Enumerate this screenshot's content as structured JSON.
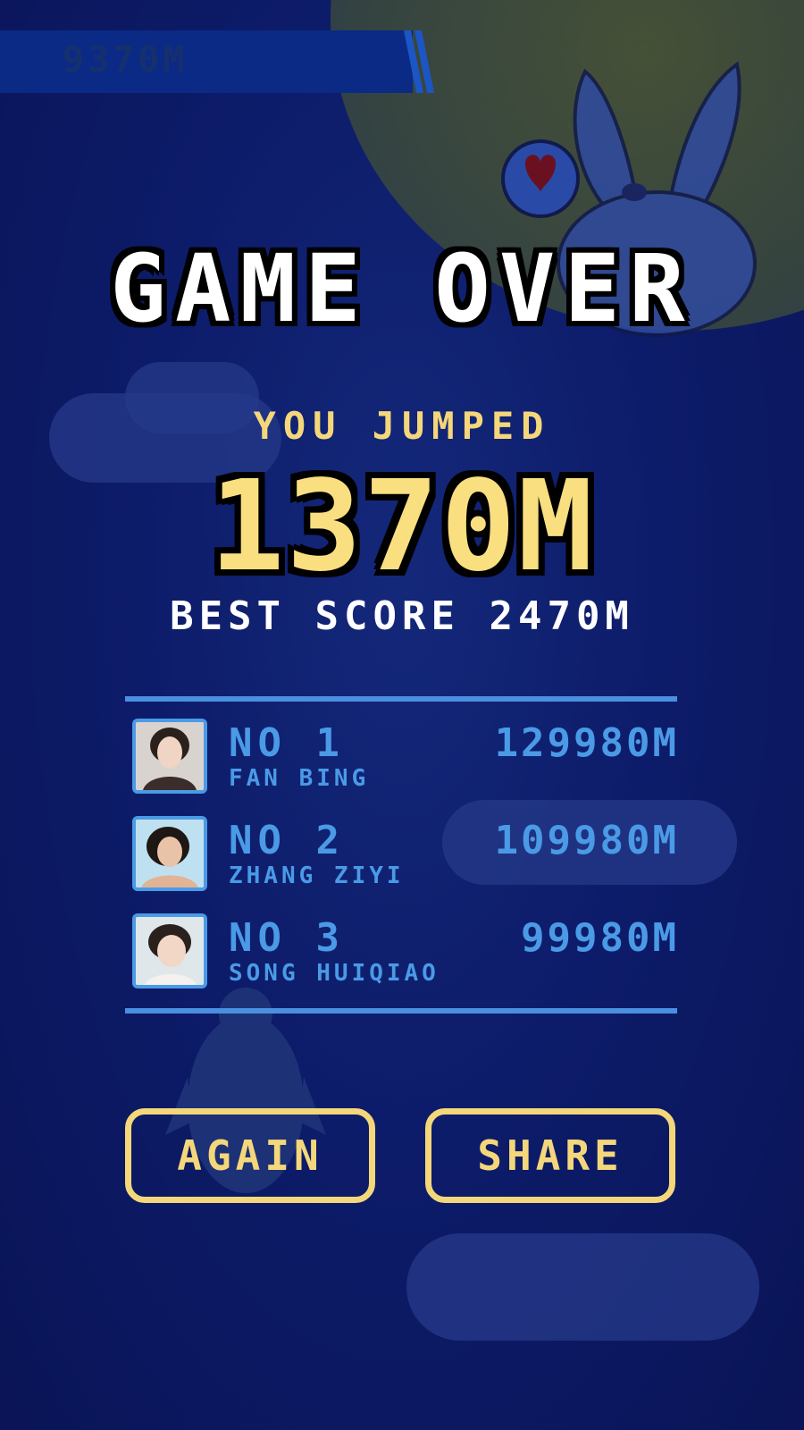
{
  "hud": {
    "current_score": "9370M"
  },
  "title": "GAME OVER",
  "result": {
    "you_jumped_label": "YOU JUMPED",
    "score": "1370M",
    "best_score_text": "BEST SCORE 2470M"
  },
  "leaderboard": [
    {
      "rank": "NO 1",
      "name": "FAN BING",
      "distance": "129980M"
    },
    {
      "rank": "NO 2",
      "name": "ZHANG ZIYI",
      "distance": "109980M"
    },
    {
      "rank": "NO 3",
      "name": "SONG HUIQIAO",
      "distance": "99980M"
    }
  ],
  "buttons": {
    "again": "AGAIN",
    "share": "SHARE"
  },
  "colors": {
    "background": "#0b1660",
    "accent_yellow": "#f4d77a",
    "leaderboard_blue": "#4a9ae6",
    "title_white": "#ffffff"
  },
  "icons": [
    "heart-speech-bubble-icon",
    "rabbit-character-icon",
    "penguin-character-icon",
    "avatar-photo-icon"
  ]
}
